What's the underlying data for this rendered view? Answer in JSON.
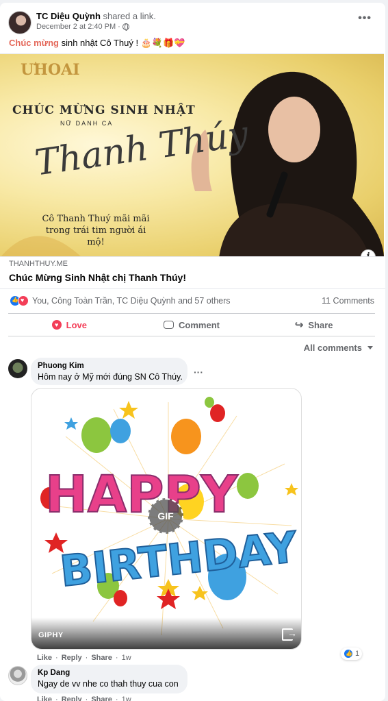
{
  "post": {
    "author": "TC Diệu Quỳnh",
    "action": "shared a link.",
    "timestamp": "December 2 at 2:40 PM",
    "text_highlight": "Chúc mừng",
    "text_rest": "sinh nhật Cô Thuý ! 🎂💐🎁💝"
  },
  "link": {
    "image_logo": "ƯHOAI",
    "image_title": "CHÚC MỪNG SINH NHẬT",
    "image_subtitle": "NỮ DANH CA",
    "image_script": "Thanh Thúy",
    "image_quote_line1": "Cô Thanh Thuý mãi mãi",
    "image_quote_line2": "trong trái tim người ái mộ!",
    "domain": "THANHTHUY.ME",
    "title": "Chúc Mừng Sinh Nhật chị Thanh Thúy!"
  },
  "reactions": {
    "summary": "You, Công Toàn Trần, TC Diệu Quỳnh and 57 others",
    "comments_count": "11 Comments"
  },
  "actions": {
    "love": "Love",
    "comment": "Comment",
    "share": "Share"
  },
  "filter": {
    "label": "All comments"
  },
  "comments": [
    {
      "name": "Phuong Kim",
      "text": "Hôm nay ở Mỹ mới đúng SN Cô Thúy.",
      "gif_text_top": "HAPPY",
      "gif_text_bottom": "BIRTHDAY",
      "gif_badge": "GIF",
      "gif_source": "GIPHY",
      "like": "Like",
      "reply": "Reply",
      "share": "Share",
      "time": "1w",
      "like_count": "1"
    },
    {
      "name": "Kp Dang",
      "text": "Ngay de vv nhe co thah thuy cua con",
      "like": "Like",
      "reply": "Reply",
      "share": "Share",
      "time": "1w"
    }
  ],
  "colors": {
    "love": "#f33e58",
    "like": "#1877f2",
    "highlight": "#e4685a"
  }
}
